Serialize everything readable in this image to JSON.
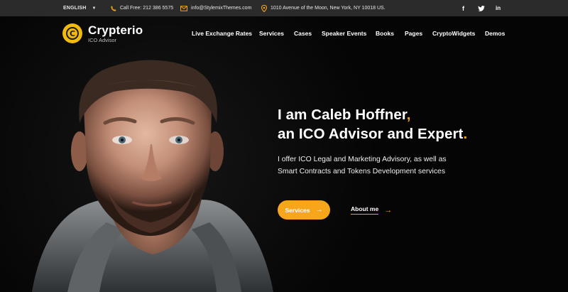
{
  "topbar": {
    "language": "ENGLISH",
    "phone": "Call Free: 212 386 5575",
    "email": "info@StylemixThemes.com",
    "address": "1010 Avenue of the Moon, New York, NY 10018 US.",
    "social": [
      "f",
      "twitter-icon",
      "in"
    ]
  },
  "brand": {
    "name": "Crypterio",
    "tagline": "ICO Advisor"
  },
  "nav": {
    "items": [
      "Live Exchange Rates",
      "Services",
      "Cases",
      "Speaker Events",
      "Books",
      "Pages",
      "CryptoWidgets",
      "Demos"
    ]
  },
  "hero": {
    "line1": "I am Caleb Hoffner",
    "line2": "an ICO Advisor and Expert",
    "punct1": ",",
    "punct2": ".",
    "sub1": "I offer ICO Legal and Marketing Advisory, as well as",
    "sub2": "Smart Contracts and Tokens Development services",
    "btn_services": "Services",
    "btn_about": "About me"
  },
  "colors": {
    "accent": "#f2a413",
    "button": "#f7a61b",
    "topbar": "#2b2b2b",
    "background": "#050505"
  }
}
